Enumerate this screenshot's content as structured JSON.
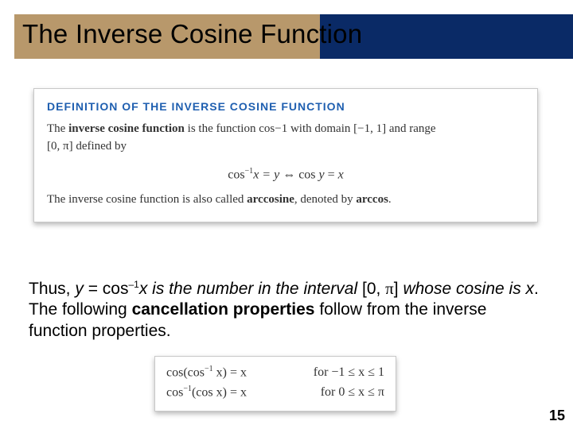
{
  "title": "The Inverse Cosine Function",
  "def": {
    "heading": "DEFINITION OF THE INVERSE COSINE FUNCTION",
    "line1_a": "The ",
    "line1_b": "inverse cosine function",
    "line1_c": " is the function cos",
    "line1_sup": "−1",
    "line1_d": " with domain [−1, 1] and range",
    "line2": "[0, π] defined by",
    "eqn_lhs_a": "cos",
    "eqn_lhs_sup": "−1",
    "eqn_lhs_b": "x = y",
    "eqn_iff": "  ⇔  ",
    "eqn_rhs": "cos y = x",
    "line3_a": "The inverse cosine function is also called ",
    "line3_b": "arccosine",
    "line3_c": ", denoted by ",
    "line3_d": "arccos",
    "line3_e": "."
  },
  "para": {
    "t1": "Thus, ",
    "t2": "y",
    "t3": " = cos",
    "sup1": "–1",
    "t4": "x is the number in the interval ",
    "t5": "[0, ",
    "pi": "π",
    "t6": "] ",
    "t7": "whose cosine is x",
    "t8": ". The following ",
    "t9": "cancellation properties",
    "t10": " follow from the inverse function properties."
  },
  "props": {
    "r1_lhs_a": "cos(cos",
    "r1_lhs_sup": "−1",
    "r1_lhs_b": " x) = x",
    "r1_rhs": "for   −1 ≤ x ≤ 1",
    "r2_lhs_a": "cos",
    "r2_lhs_sup": "−1",
    "r2_lhs_b": "(cos x) = x",
    "r2_rhs": "for    0 ≤ x ≤ π"
  },
  "page": "15"
}
